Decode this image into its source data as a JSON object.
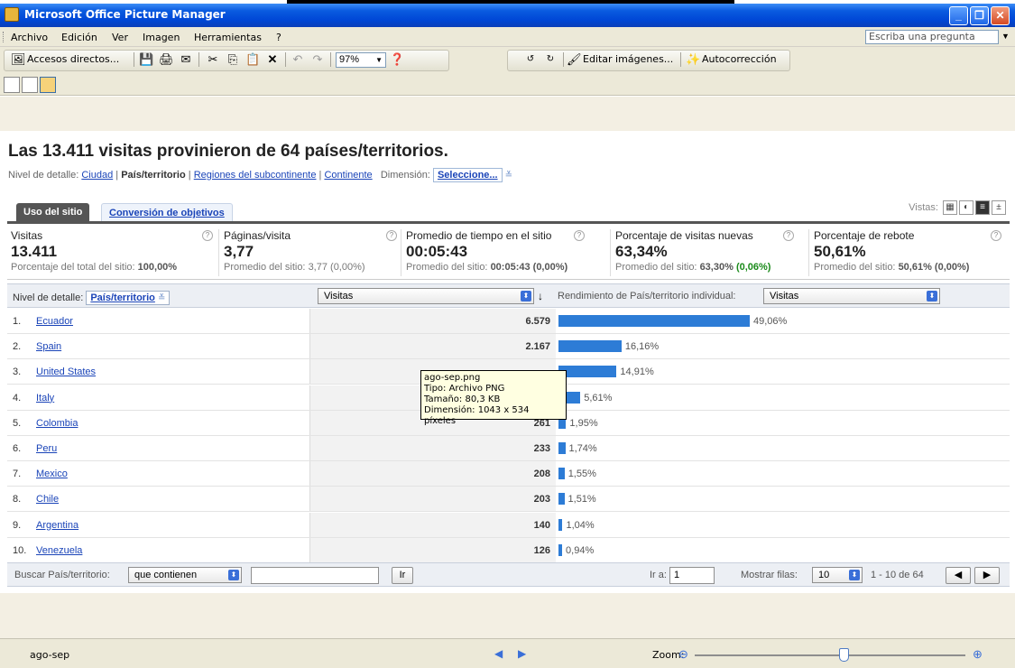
{
  "window": {
    "title": "Microsoft Office Picture Manager"
  },
  "menu": {
    "items": [
      "Archivo",
      "Edición",
      "Ver",
      "Imagen",
      "Herramientas",
      "?"
    ],
    "ask_placeholder": "Escriba una pregunta"
  },
  "toolbar": {
    "shortcuts_label": "Accesos directos...",
    "zoom_value": "97%",
    "edit_label": "Editar imágenes...",
    "autocorrect_label": "Autocorrección"
  },
  "page": {
    "headline": "Las 13.411 visitas provinieron de 64 países/territorios.",
    "detail_label": "Nivel de detalle:",
    "detail_links": {
      "city": "Ciudad",
      "country": "País/territorio",
      "subcontinent": "Regiones del subcontinente",
      "continent": "Continente"
    },
    "dimension_label": "Dimensión:",
    "dimension_select": "Seleccione...",
    "tabs": [
      "Uso del sitio",
      "Conversión de objetivos"
    ],
    "views_label": "Vistas:"
  },
  "metrics": [
    {
      "label": "Visitas",
      "value": "13.411",
      "sub_label": "Porcentaje del total del sitio:",
      "sub_value": "100,00%",
      "delta": ""
    },
    {
      "label": "Páginas/visita",
      "value": "3,77",
      "sub_label": "Promedio del sitio:",
      "sub_value": "3,77 (0,00%)",
      "delta": ""
    },
    {
      "label": "Promedio de tiempo en el sitio",
      "value": "00:05:43",
      "sub_label": "Promedio del sitio:",
      "sub_value": "00:05:43 (0,00%)",
      "delta": ""
    },
    {
      "label": "Porcentaje de visitas nuevas",
      "value": "63,34%",
      "sub_label": "Promedio del sitio:",
      "sub_value": "63,30%",
      "delta": "(0,06%)"
    },
    {
      "label": "Porcentaje de rebote",
      "value": "50,61%",
      "sub_label": "Promedio del sitio:",
      "sub_value": "50,61% (0,00%)",
      "delta": ""
    }
  ],
  "table": {
    "detail_label": "Nivel de detalle:",
    "detail_value": "País/territorio",
    "metric_select": "Visitas",
    "performance_label": "Rendimiento de País/territorio individual:",
    "performance_select": "Visitas",
    "rows": [
      {
        "rank": "1.",
        "country": "Ecuador",
        "visits": "6.579",
        "pct": "49,06%",
        "share": 49.06
      },
      {
        "rank": "2.",
        "country": "Spain",
        "visits": "2.167",
        "pct": "16,16%",
        "share": 16.16
      },
      {
        "rank": "3.",
        "country": "United States",
        "visits": "",
        "pct": "14,91%",
        "share": 14.91
      },
      {
        "rank": "4.",
        "country": "Italy",
        "visits": "",
        "pct": "5,61%",
        "share": 5.61
      },
      {
        "rank": "5.",
        "country": "Colombia",
        "visits": "261",
        "pct": "1,95%",
        "share": 1.95
      },
      {
        "rank": "6.",
        "country": "Peru",
        "visits": "233",
        "pct": "1,74%",
        "share": 1.74
      },
      {
        "rank": "7.",
        "country": "Mexico",
        "visits": "208",
        "pct": "1,55%",
        "share": 1.55
      },
      {
        "rank": "8.",
        "country": "Chile",
        "visits": "203",
        "pct": "1,51%",
        "share": 1.51
      },
      {
        "rank": "9.",
        "country": "Argentina",
        "visits": "140",
        "pct": "1,04%",
        "share": 1.04
      },
      {
        "rank": "10.",
        "country": "Venezuela",
        "visits": "126",
        "pct": "0,94%",
        "share": 0.94
      }
    ],
    "footer": {
      "search_label": "Buscar País/territorio:",
      "filter_select": "que contienen",
      "go_button": "Ir",
      "goto_label": "Ir a:",
      "goto_value": "1",
      "rows_label": "Mostrar filas:",
      "rows_value": "10",
      "range": "1 - 10 de 64"
    }
  },
  "tooltip": {
    "line1": "ago-sep.png",
    "line2": "Tipo: Archivo PNG",
    "line3": "Tamaño: 80,3 KB",
    "line4": "Dimensión: 1043 x 534 píxeles"
  },
  "status": {
    "filename": "ago-sep",
    "zoom_label": "Zoom:",
    "zoom_level": 0.55
  },
  "colors": {
    "bar": "#2d7cd6",
    "link": "#1a44b8",
    "titlebar": "#0047d6",
    "positive": "#1a8a1a"
  }
}
